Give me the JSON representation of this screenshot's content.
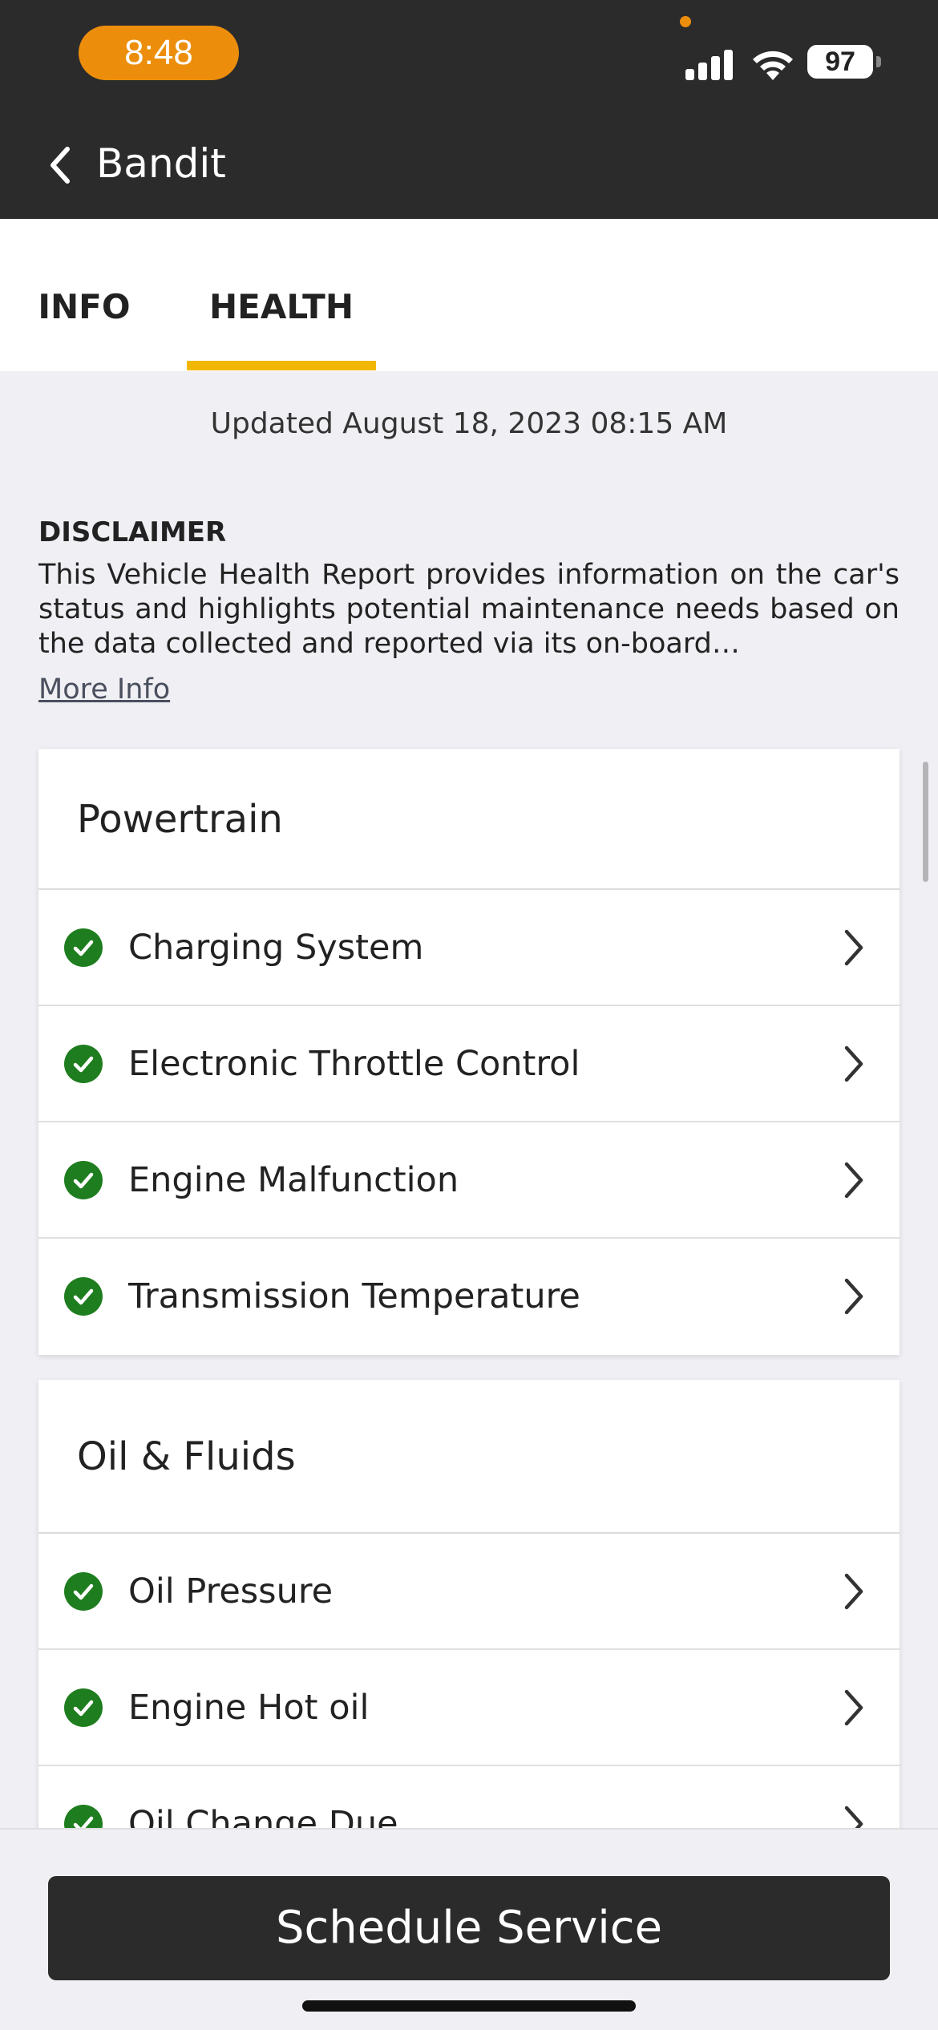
{
  "status_bar": {
    "time": "8:48",
    "battery": "97",
    "icons": [
      "cellular-signal-icon",
      "wifi-icon",
      "battery-icon"
    ]
  },
  "nav": {
    "back_icon": "chevron-left-icon",
    "title": "Bandit"
  },
  "tabs": [
    {
      "label": "INFO",
      "active": false
    },
    {
      "label": "HEALTH",
      "active": true
    }
  ],
  "updated_text": "Updated August 18, 2023 08:15 AM",
  "disclaimer": {
    "title": "DISCLAIMER",
    "text": "This Vehicle Health Report provides information on the car's status and highlights potential maintenance needs based on the data collected and reported via its on-board…",
    "more_info": "More Info"
  },
  "sections": [
    {
      "title": "Powertrain",
      "items": [
        {
          "label": "Charging System",
          "status": "ok"
        },
        {
          "label": "Electronic Throttle Control",
          "status": "ok"
        },
        {
          "label": "Engine Malfunction",
          "status": "ok"
        },
        {
          "label": "Transmission Temperature",
          "status": "ok"
        }
      ]
    },
    {
      "title": "Oil & Fluids",
      "items": [
        {
          "label": "Oil Pressure",
          "status": "ok"
        },
        {
          "label": "Engine Hot oil",
          "status": "ok"
        },
        {
          "label": "Oil Change Due",
          "status": "ok"
        }
      ]
    }
  ],
  "schedule_button": "Schedule Service",
  "colors": {
    "accent": "#f2b705",
    "time_pill": "#ec8e0c",
    "ok_green": "#1e7d1e",
    "dark": "#2b2b2b"
  }
}
